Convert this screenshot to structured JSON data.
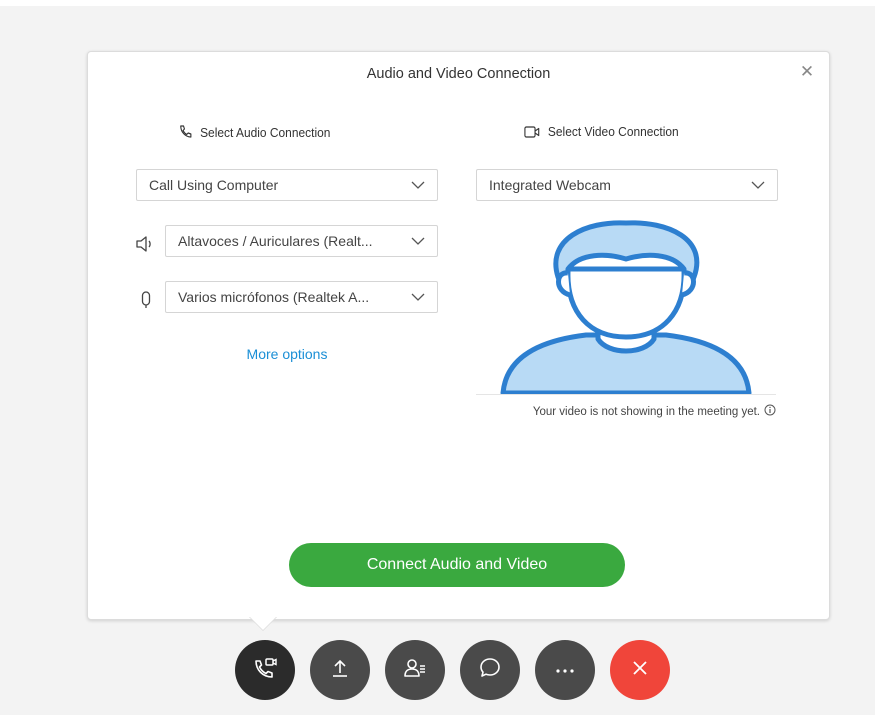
{
  "dialog": {
    "title": "Audio and Video Connection",
    "close_icon": "close-icon"
  },
  "audio": {
    "heading": "Select Audio Connection",
    "connection_value": "Call Using Computer",
    "speaker_value": "Altavoces / Auriculares (Realt...",
    "microphone_value": "Varios micrófonos (Realtek A...",
    "more_options": "More options"
  },
  "video": {
    "heading": "Select Video Connection",
    "camera_value": "Integrated Webcam",
    "note": "Your video is not showing in the meeting yet."
  },
  "connect_button": "Connect Audio and Video",
  "toolbar": {
    "buttons": [
      "audio-video-icon",
      "share-icon",
      "participants-icon",
      "chat-icon",
      "more-icon",
      "leave-icon"
    ]
  },
  "colors": {
    "accent_green": "#3aa93f",
    "link_blue": "#1b8fd6",
    "toolbar_dark": "#4a4a4a",
    "toolbar_active": "#2b2b2b",
    "leave_red": "#f0453a",
    "avatar_fill": "#b8daf5",
    "avatar_stroke": "#2d7fd0"
  }
}
